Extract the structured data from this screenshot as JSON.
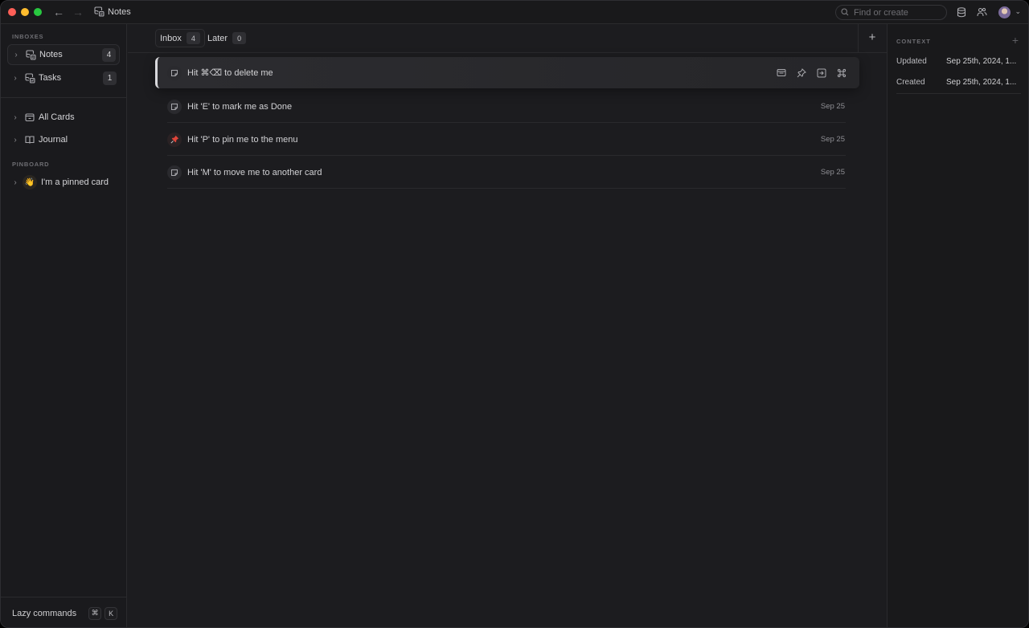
{
  "window": {
    "title": "Notes",
    "search_placeholder": "Find or create"
  },
  "sidebar": {
    "inboxes_label": "INBOXES",
    "inboxes": [
      {
        "label": "Notes",
        "count": "4",
        "icon": "inbox-note-icon"
      },
      {
        "label": "Tasks",
        "count": "1",
        "icon": "inbox-task-icon"
      }
    ],
    "views": [
      {
        "label": "All Cards",
        "icon": "cards-icon"
      },
      {
        "label": "Journal",
        "icon": "book-icon"
      }
    ],
    "pinboard_label": "PINBOARD",
    "pinned": [
      {
        "label": "I'm a pinned card",
        "emoji": "👋"
      }
    ],
    "footer": {
      "label": "Lazy commands",
      "keys": [
        "⌘",
        "K"
      ]
    }
  },
  "main": {
    "tabs": [
      {
        "label": "Inbox",
        "count": "4"
      },
      {
        "label": "Later",
        "count": "0"
      }
    ],
    "cards": [
      {
        "title": "Hit ⌘⌫ to delete me",
        "date": "",
        "icon": "note-icon",
        "selected": true
      },
      {
        "title": "Hit 'E' to mark me as Done",
        "date": "Sep 25",
        "icon": "note-icon"
      },
      {
        "title": "Hit 'P' to pin me to the menu",
        "date": "Sep 25",
        "icon": "pushpin-icon"
      },
      {
        "title": "Hit 'M' to move me to another card",
        "date": "Sep 25",
        "icon": "note-icon"
      }
    ]
  },
  "context": {
    "label": "CONTEXT",
    "rows": [
      {
        "key": "Updated",
        "value": "Sep 25th, 2024, 1..."
      },
      {
        "key": "Created",
        "value": "Sep 25th, 2024, 1..."
      }
    ]
  },
  "colors": {
    "pin": "#e0453a",
    "close": "#fe5f57",
    "minimize": "#febc2e",
    "zoom": "#28c840"
  }
}
